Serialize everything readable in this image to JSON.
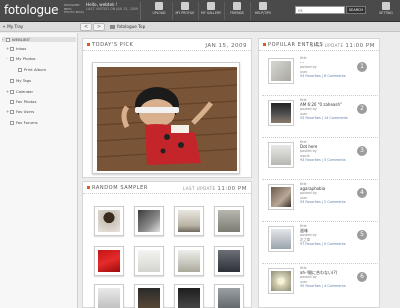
{
  "app": {
    "logo": "fotologue",
    "logo_tag": [
      "DESIGNER",
      "BETA",
      "PHOTO BLOG"
    ],
    "greeting": "Hello, webtek !",
    "greeting_sub": "LAST VISITED ON JAN 15, 2009"
  },
  "toolbar": [
    {
      "label": "UPLOAD",
      "icon": "upload-icon"
    },
    {
      "label": "MY PROFILE",
      "icon": "profile-icon"
    },
    {
      "label": "MY GALLERY",
      "icon": "gallery-icon"
    },
    {
      "label": "FRIENDS",
      "icon": "friends-icon"
    },
    {
      "label": "HELP/TIPS",
      "icon": "help-icon"
    }
  ],
  "search": {
    "placeholder": "ok",
    "button": "SEARCH"
  },
  "settings_label": "SETTING",
  "nav": {
    "tray": "My Tray",
    "breadcrumb": "fotologue Top",
    "back": "<",
    "forward": ">",
    "up": "^"
  },
  "sidebar": [
    {
      "label": "WEBLIBIT",
      "toggle": "-",
      "indent": 0
    },
    {
      "label": "Inbox",
      "toggle": "+",
      "indent": 1
    },
    {
      "label": "My Photos",
      "toggle": "-",
      "indent": 1
    },
    {
      "label": "Print Album",
      "toggle": "",
      "indent": 2
    },
    {
      "label": "My Tags",
      "toggle": "",
      "indent": 1
    },
    {
      "label": "Calendar",
      "toggle": "+",
      "indent": 1
    },
    {
      "label": "Fav Photos",
      "toggle": "",
      "indent": 1
    },
    {
      "label": "Fav Users",
      "toggle": "+",
      "indent": 1
    },
    {
      "label": "Fav Forums",
      "toggle": "",
      "indent": 1
    }
  ],
  "pick": {
    "title": "TODAY'S PICK",
    "date": "JAN 15, 2009"
  },
  "random": {
    "title": "RANDOM SAMPLER",
    "meta_prefix": "LAST UPDATE",
    "time": "11:00 PM"
  },
  "popular": {
    "title": "POPULAR ENTRIES",
    "meta_prefix": "LAST UPDATE",
    "time": "11:00 PM",
    "items": [
      {
        "rank": "1",
        "by_label": "title",
        "title": "- -",
        "posted_label": "posted by",
        "user": "user",
        "counts": "93 Favorites | 6 Comments"
      },
      {
        "rank": "2",
        "by_label": "title",
        "title": "AM 6:20 \"0 zaheash\"",
        "posted_label": "posted by",
        "user": "user",
        "counts": "53 Favorites | 14 Comments"
      },
      {
        "rank": "3",
        "by_label": "title",
        "title": "Dot here",
        "posted_label": "posted by",
        "user": "wacik",
        "counts": "93 Favorites | 5 Comments"
      },
      {
        "rank": "4",
        "by_label": "title",
        "title": "agaraphobia",
        "posted_label": "posted by",
        "user": "user",
        "counts": "93 Favorites | 2 Comments"
      },
      {
        "rank": "5",
        "by_label": "title",
        "title": "滋味",
        "posted_label": "posted by",
        "user": "花之草",
        "counts": "97 Favorites | 0 Comments"
      },
      {
        "rank": "6",
        "by_label": "title",
        "title": "ah-!間に合わない(?)",
        "posted_label": "posted by",
        "user": "user",
        "counts": "95 Favorites | 4 Comments"
      }
    ]
  },
  "colors": {
    "accent": "#e05a1e",
    "topbar": "#4a4a4a",
    "rank": "#9c9c9c"
  }
}
